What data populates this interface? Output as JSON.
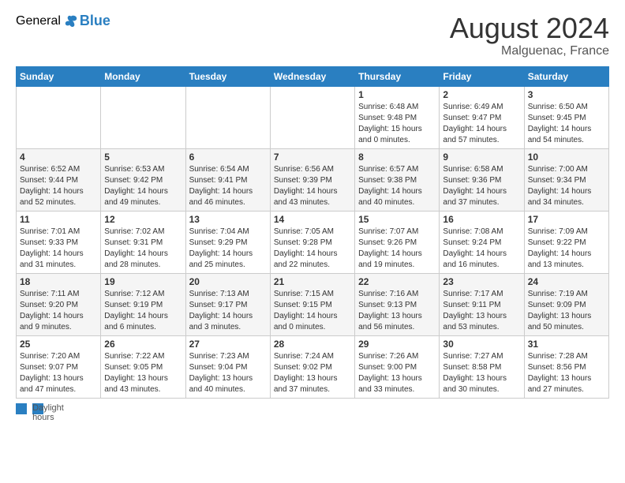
{
  "logo": {
    "general": "General",
    "blue": "Blue"
  },
  "header": {
    "title": "August 2024",
    "location": "Malguenac, France"
  },
  "days_of_week": [
    "Sunday",
    "Monday",
    "Tuesday",
    "Wednesday",
    "Thursday",
    "Friday",
    "Saturday"
  ],
  "weeks": [
    [
      {
        "day": "",
        "info": ""
      },
      {
        "day": "",
        "info": ""
      },
      {
        "day": "",
        "info": ""
      },
      {
        "day": "",
        "info": ""
      },
      {
        "day": "1",
        "info": "Sunrise: 6:48 AM\nSunset: 9:48 PM\nDaylight: 15 hours\nand 0 minutes."
      },
      {
        "day": "2",
        "info": "Sunrise: 6:49 AM\nSunset: 9:47 PM\nDaylight: 14 hours\nand 57 minutes."
      },
      {
        "day": "3",
        "info": "Sunrise: 6:50 AM\nSunset: 9:45 PM\nDaylight: 14 hours\nand 54 minutes."
      }
    ],
    [
      {
        "day": "4",
        "info": "Sunrise: 6:52 AM\nSunset: 9:44 PM\nDaylight: 14 hours\nand 52 minutes."
      },
      {
        "day": "5",
        "info": "Sunrise: 6:53 AM\nSunset: 9:42 PM\nDaylight: 14 hours\nand 49 minutes."
      },
      {
        "day": "6",
        "info": "Sunrise: 6:54 AM\nSunset: 9:41 PM\nDaylight: 14 hours\nand 46 minutes."
      },
      {
        "day": "7",
        "info": "Sunrise: 6:56 AM\nSunset: 9:39 PM\nDaylight: 14 hours\nand 43 minutes."
      },
      {
        "day": "8",
        "info": "Sunrise: 6:57 AM\nSunset: 9:38 PM\nDaylight: 14 hours\nand 40 minutes."
      },
      {
        "day": "9",
        "info": "Sunrise: 6:58 AM\nSunset: 9:36 PM\nDaylight: 14 hours\nand 37 minutes."
      },
      {
        "day": "10",
        "info": "Sunrise: 7:00 AM\nSunset: 9:34 PM\nDaylight: 14 hours\nand 34 minutes."
      }
    ],
    [
      {
        "day": "11",
        "info": "Sunrise: 7:01 AM\nSunset: 9:33 PM\nDaylight: 14 hours\nand 31 minutes."
      },
      {
        "day": "12",
        "info": "Sunrise: 7:02 AM\nSunset: 9:31 PM\nDaylight: 14 hours\nand 28 minutes."
      },
      {
        "day": "13",
        "info": "Sunrise: 7:04 AM\nSunset: 9:29 PM\nDaylight: 14 hours\nand 25 minutes."
      },
      {
        "day": "14",
        "info": "Sunrise: 7:05 AM\nSunset: 9:28 PM\nDaylight: 14 hours\nand 22 minutes."
      },
      {
        "day": "15",
        "info": "Sunrise: 7:07 AM\nSunset: 9:26 PM\nDaylight: 14 hours\nand 19 minutes."
      },
      {
        "day": "16",
        "info": "Sunrise: 7:08 AM\nSunset: 9:24 PM\nDaylight: 14 hours\nand 16 minutes."
      },
      {
        "day": "17",
        "info": "Sunrise: 7:09 AM\nSunset: 9:22 PM\nDaylight: 14 hours\nand 13 minutes."
      }
    ],
    [
      {
        "day": "18",
        "info": "Sunrise: 7:11 AM\nSunset: 9:20 PM\nDaylight: 14 hours\nand 9 minutes."
      },
      {
        "day": "19",
        "info": "Sunrise: 7:12 AM\nSunset: 9:19 PM\nDaylight: 14 hours\nand 6 minutes."
      },
      {
        "day": "20",
        "info": "Sunrise: 7:13 AM\nSunset: 9:17 PM\nDaylight: 14 hours\nand 3 minutes."
      },
      {
        "day": "21",
        "info": "Sunrise: 7:15 AM\nSunset: 9:15 PM\nDaylight: 14 hours\nand 0 minutes."
      },
      {
        "day": "22",
        "info": "Sunrise: 7:16 AM\nSunset: 9:13 PM\nDaylight: 13 hours\nand 56 minutes."
      },
      {
        "day": "23",
        "info": "Sunrise: 7:17 AM\nSunset: 9:11 PM\nDaylight: 13 hours\nand 53 minutes."
      },
      {
        "day": "24",
        "info": "Sunrise: 7:19 AM\nSunset: 9:09 PM\nDaylight: 13 hours\nand 50 minutes."
      }
    ],
    [
      {
        "day": "25",
        "info": "Sunrise: 7:20 AM\nSunset: 9:07 PM\nDaylight: 13 hours\nand 47 minutes."
      },
      {
        "day": "26",
        "info": "Sunrise: 7:22 AM\nSunset: 9:05 PM\nDaylight: 13 hours\nand 43 minutes."
      },
      {
        "day": "27",
        "info": "Sunrise: 7:23 AM\nSunset: 9:04 PM\nDaylight: 13 hours\nand 40 minutes."
      },
      {
        "day": "28",
        "info": "Sunrise: 7:24 AM\nSunset: 9:02 PM\nDaylight: 13 hours\nand 37 minutes."
      },
      {
        "day": "29",
        "info": "Sunrise: 7:26 AM\nSunset: 9:00 PM\nDaylight: 13 hours\nand 33 minutes."
      },
      {
        "day": "30",
        "info": "Sunrise: 7:27 AM\nSunset: 8:58 PM\nDaylight: 13 hours\nand 30 minutes."
      },
      {
        "day": "31",
        "info": "Sunrise: 7:28 AM\nSunset: 8:56 PM\nDaylight: 13 hours\nand 27 minutes."
      }
    ]
  ],
  "footer": {
    "label": "Daylight hours"
  },
  "colors": {
    "header_bg": "#2a7fc1"
  }
}
